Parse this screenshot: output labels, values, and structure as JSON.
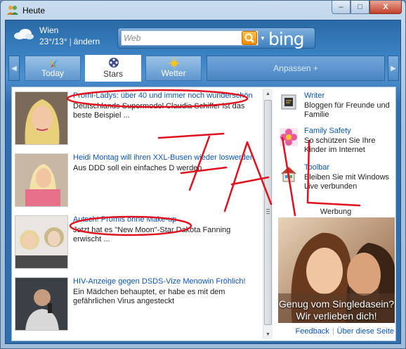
{
  "window": {
    "title": "Heute",
    "buttons": {
      "minimize": "–",
      "maximize": "□",
      "close": "X"
    }
  },
  "weather": {
    "city": "Wien",
    "high": "23°",
    "low": "13°",
    "change_label": "ändern",
    "icon": "cloud-icon"
  },
  "search": {
    "placeholder": "Web",
    "engine": "bing"
  },
  "tabs": [
    {
      "label": "Today",
      "icon": "msn-butterfly-icon",
      "active": false
    },
    {
      "label": "Stars",
      "icon": "film-reel-icon",
      "active": true
    },
    {
      "label": "Wetter",
      "icon": "sun-icon",
      "active": false
    }
  ],
  "customize_label": "Anpassen +",
  "news": [
    {
      "headline": "Promi-Ladys: über 40 und immer noch wunderschön",
      "summary": "Deutschlands Supermodel Claudia Schiffer ist das beste Beispiel ..."
    },
    {
      "headline": "Heidi Montag will ihren XXL-Busen wieder loswerden",
      "summary": "Aus DDD soll ein einfaches D werden ..."
    },
    {
      "headline": "Autsch! Promis ohne Make-up",
      "summary": "Jetzt hat es \"New Moon\"-Star Dakota Fanning erwischt ..."
    },
    {
      "headline": "HIV-Anzeige gegen DSDS-Vize Menowin Fröhlich!",
      "summary": "Ein Mädchen behauptet, er habe es mit dem gefährlichen Virus angesteckt"
    }
  ],
  "sidebar": [
    {
      "title": "Writer",
      "desc": "Bloggen für Freunde und Familie",
      "icon": "writer-icon"
    },
    {
      "title": "Family Safety",
      "desc": "So schützen Sie Ihre Kinder im Internet",
      "icon": "flower-icon"
    },
    {
      "title": "Toolbar",
      "desc": "Bleiben Sie mit Windows Live verbunden",
      "icon": "house-icon"
    }
  ],
  "ad": {
    "label": "Werbung",
    "line1": "Genug vom Singledasein?",
    "line2": "Wir verlieben dich!"
  },
  "footer": {
    "feedback": "Feedback",
    "divider": "|",
    "about": "Über diese Seite"
  },
  "annotation": {
    "text": "FAIL",
    "color": "#e0101e"
  }
}
